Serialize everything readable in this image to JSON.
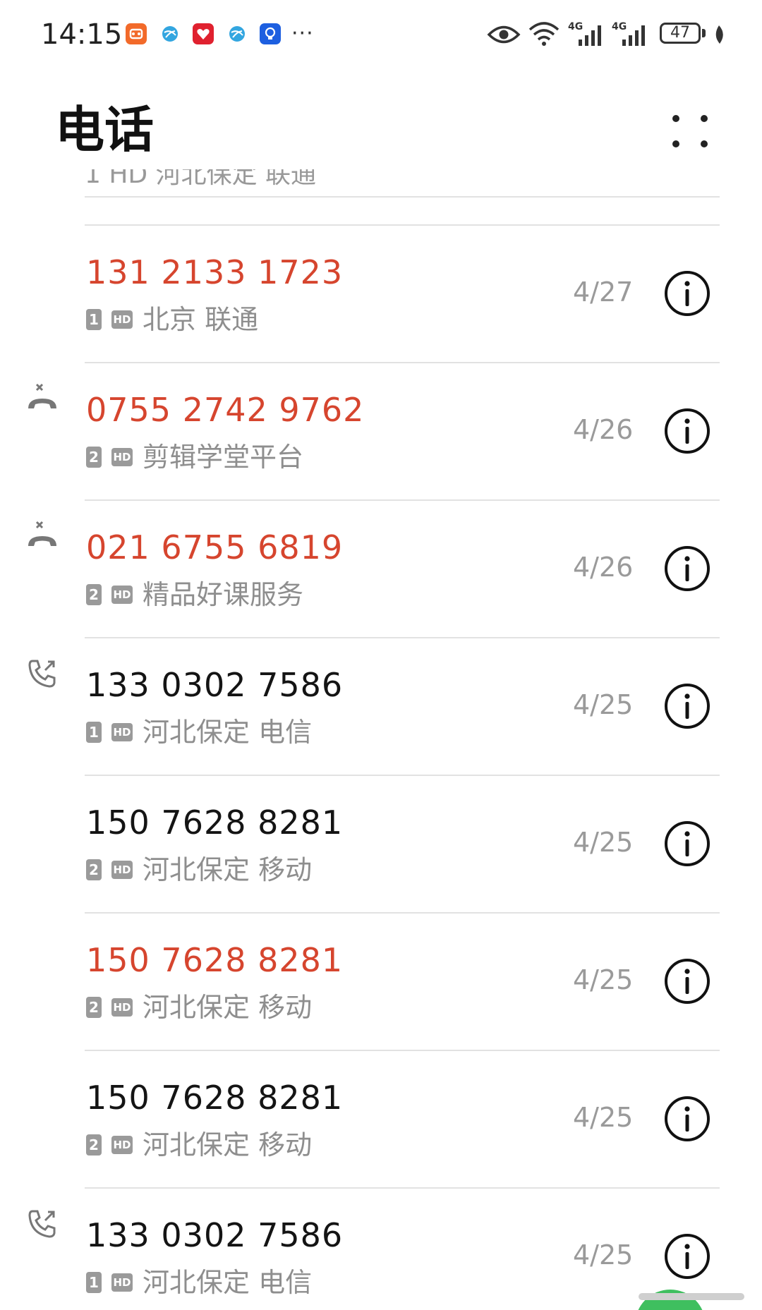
{
  "status_bar": {
    "time": "14:15",
    "more": "···",
    "battery": "47",
    "signal_labels": [
      "4G",
      "4G"
    ]
  },
  "header": {
    "title": "电话"
  },
  "calls": {
    "partial_top_text": "1 HD 河北保定 联通",
    "items": [
      {
        "number": "131 2133 1723",
        "sim": "1",
        "hd": "HD",
        "location": "北京 联通",
        "date": "4/27",
        "type": "missed",
        "icon": ""
      },
      {
        "number": "0755 2742 9762",
        "sim": "2",
        "hd": "HD",
        "location": "剪辑学堂平台",
        "date": "4/26",
        "type": "missed",
        "icon": "rejected-call-icon"
      },
      {
        "number": "021 6755 6819",
        "sim": "2",
        "hd": "HD",
        "location": "精品好课服务",
        "date": "4/26",
        "type": "missed",
        "icon": "rejected-call-icon"
      },
      {
        "number": "133 0302 7586",
        "sim": "1",
        "hd": "HD",
        "location": "河北保定 电信",
        "date": "4/25",
        "type": "normal",
        "icon": "outgoing-call-icon"
      },
      {
        "number": "150 7628 8281",
        "sim": "2",
        "hd": "HD",
        "location": "河北保定 移动",
        "date": "4/25",
        "type": "normal",
        "icon": ""
      },
      {
        "number": "150 7628 8281",
        "sim": "2",
        "hd": "HD",
        "location": "河北保定 移动",
        "date": "4/25",
        "type": "missed",
        "icon": ""
      },
      {
        "number": "150 7628 8281",
        "sim": "2",
        "hd": "HD",
        "location": "河北保定 移动",
        "date": "4/25",
        "type": "normal",
        "icon": ""
      },
      {
        "number": "133 0302 7586",
        "sim": "1",
        "hd": "HD",
        "location": "河北保定 电信",
        "date": "4/25",
        "type": "normal",
        "icon": "outgoing-call-icon"
      }
    ]
  },
  "colors": {
    "missed": "#d6452e",
    "normal": "#141414",
    "secondary": "#8e8e8e",
    "divider": "#e2e2e2"
  }
}
